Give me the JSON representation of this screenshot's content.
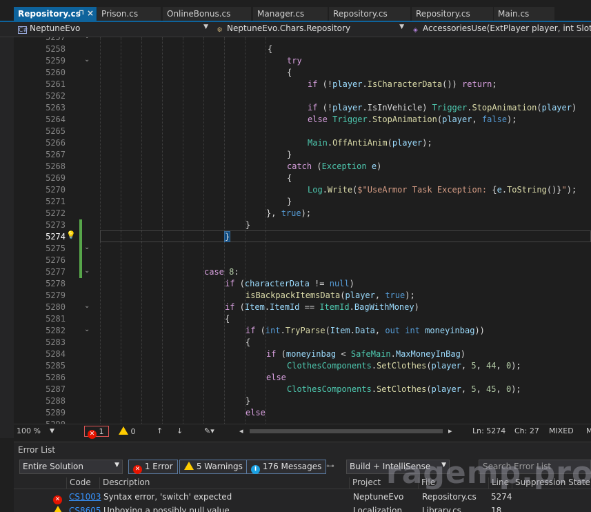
{
  "tabs": [
    {
      "label": "Repository.cs",
      "active": true
    },
    {
      "label": "Prison.cs"
    },
    {
      "label": "OnlineBonus.cs"
    },
    {
      "label": "Manager.cs"
    },
    {
      "label": "Repository.cs"
    },
    {
      "label": "Repository.cs"
    },
    {
      "label": "Main.cs"
    }
  ],
  "nav": {
    "project": "NeptuneEvo",
    "class": "NeptuneEvo.Chars.Repository",
    "member": "AccessoriesUse(ExtPlayer player, int SlotId, boo"
  },
  "editor": {
    "current_line": "5274",
    "line_numbers": [
      "5257",
      "5258",
      "5259",
      "5260",
      "5261",
      "5262",
      "5263",
      "5264",
      "5265",
      "5266",
      "5267",
      "5268",
      "5269",
      "5270",
      "5271",
      "5272",
      "5273",
      "5274",
      "5275",
      "5276",
      "5277",
      "5278",
      "5279",
      "5280",
      "5281",
      "5282",
      "5283",
      "5284",
      "5285",
      "5286",
      "5287",
      "5288",
      "5289",
      "5290"
    ],
    "code": {
      "l5258": "{",
      "l5259_kw": "try",
      "l5260": "{",
      "l5261_if": "if",
      "l5261_a": " (!",
      "l5261_v": "player",
      "l5261_b": ".",
      "l5261_m": "IsCharacterData",
      "l5261_c": "()) ",
      "l5261_ret": "return",
      "l5261_d": ";",
      "l5263_if": "if",
      "l5263_a": " (!",
      "l5263_v": "player",
      "l5263_b": ".IsInVehicle) ",
      "l5263_t": "Trigger",
      "l5263_c": ".",
      "l5263_m": "StopAnimation",
      "l5263_d": "(",
      "l5263_v2": "player",
      "l5263_e": ")",
      "l5264_else": "else",
      "l5264_t": "Trigger",
      "l5264_a": ".",
      "l5264_m": "StopAnimation",
      "l5264_b": "(",
      "l5264_v": "player",
      "l5264_c": ", ",
      "l5264_f": "false",
      "l5264_d": ");",
      "l5266_t": "Main",
      "l5266_a": ".",
      "l5266_m": "OffAntiAnim",
      "l5266_b": "(",
      "l5266_v": "player",
      "l5266_c": ");",
      "l5267": "}",
      "l5268_catch": "catch",
      "l5268_a": " (",
      "l5268_t": "Exception",
      "l5268_b": " ",
      "l5268_v": "e",
      "l5268_c": ")",
      "l5269": "{",
      "l5270_t": "Log",
      "l5270_a": ".",
      "l5270_m": "Write",
      "l5270_b": "(",
      "l5270_s": "$\"UseArmor Task Exception: ",
      "l5270_c": "{",
      "l5270_v": "e",
      "l5270_d": ".",
      "l5270_m2": "ToString",
      "l5270_e": "()}",
      "l5270_s2": "\"",
      "l5270_f": ");",
      "l5271": "}",
      "l5272_a": "}, ",
      "l5272_true": "true",
      "l5272_b": ");",
      "l5273": "}",
      "l5274": "}",
      "l5277_case": "case",
      "l5277_n": " 8",
      "l5277_a": ":",
      "l5278_if": "if",
      "l5278_a": " (",
      "l5278_v": "characterData",
      "l5278_b": " != ",
      "l5278_null": "null",
      "l5278_c": ")",
      "l5279_m": "isBackpackItemsData",
      "l5279_a": "(",
      "l5279_v": "player",
      "l5279_b": ", ",
      "l5279_true": "true",
      "l5279_c": ");",
      "l5280_if": "if",
      "l5280_a": " (",
      "l5280_v": "Item",
      "l5280_b": ".",
      "l5280_v2": "ItemId",
      "l5280_c": " == ",
      "l5280_t": "ItemId",
      "l5280_d": ".",
      "l5280_v3": "BagWithMoney",
      "l5280_e": ")",
      "l5281": "{",
      "l5282_if": "if",
      "l5282_a": " (",
      "l5282_int": "int",
      "l5282_b": ".",
      "l5282_m": "TryParse",
      "l5282_c": "(",
      "l5282_v": "Item",
      "l5282_d": ".",
      "l5282_v2": "Data",
      "l5282_e": ", ",
      "l5282_out": "out",
      "l5282_f": " ",
      "l5282_int2": "int",
      "l5282_g": " ",
      "l5282_v3": "moneyinbag",
      "l5282_h": "))",
      "l5283": "{",
      "l5284_if": "if",
      "l5284_a": " (",
      "l5284_v": "moneyinbag",
      "l5284_b": " < ",
      "l5284_t": "SafeMain",
      "l5284_c": ".",
      "l5284_v2": "MaxMoneyInBag",
      "l5284_d": ")",
      "l5285_t": "ClothesComponents",
      "l5285_a": ".",
      "l5285_m": "SetClothes",
      "l5285_b": "(",
      "l5285_v": "player",
      "l5285_c": ", ",
      "l5285_n1": "5",
      "l5285_d": ", ",
      "l5285_n2": "44",
      "l5285_e": ", ",
      "l5285_n3": "0",
      "l5285_f": ");",
      "l5286_else": "else",
      "l5287_t": "ClothesComponents",
      "l5287_a": ".",
      "l5287_m": "SetClothes",
      "l5287_b": "(",
      "l5287_v": "player",
      "l5287_c": ", ",
      "l5287_n1": "5",
      "l5287_d": ", ",
      "l5287_n2": "45",
      "l5287_e": ", ",
      "l5287_n3": "0",
      "l5287_f": ");",
      "l5288": "}",
      "l5289_else": "else"
    }
  },
  "status": {
    "zoom": "100 %",
    "errors": "1",
    "warnings": "0",
    "ln": "Ln: 5274",
    "ch": "Ch: 27",
    "eol": "MIXED",
    "extra": "M"
  },
  "error_list": {
    "title": "Error List",
    "scope": "Entire Solution",
    "errors_btn": "1 Error",
    "warnings_btn": "5 Warnings",
    "messages_btn": "176 Messages",
    "build_filter": "Build + IntelliSense",
    "search_placeholder": "Search Error List",
    "columns": [
      "Code",
      "Description",
      "Project",
      "File",
      "Line",
      "Suppression State"
    ],
    "rows": [
      {
        "severity": "error",
        "code": "CS1003",
        "description": "Syntax error, 'switch' expected",
        "project": "NeptuneEvo",
        "file": "Repository.cs",
        "line": "5274"
      },
      {
        "severity": "warning",
        "code": "CS8605",
        "description": "Unboxing a possibly null value.",
        "project": "Localization",
        "file": "Library.cs",
        "line": "18"
      }
    ]
  },
  "watermark": "ragemp.pro",
  "colors": {
    "accent": "#0e639c",
    "error": "#e51400",
    "warning": "#ffcc00",
    "info": "#1ba1e2",
    "change": "#57a64a"
  }
}
